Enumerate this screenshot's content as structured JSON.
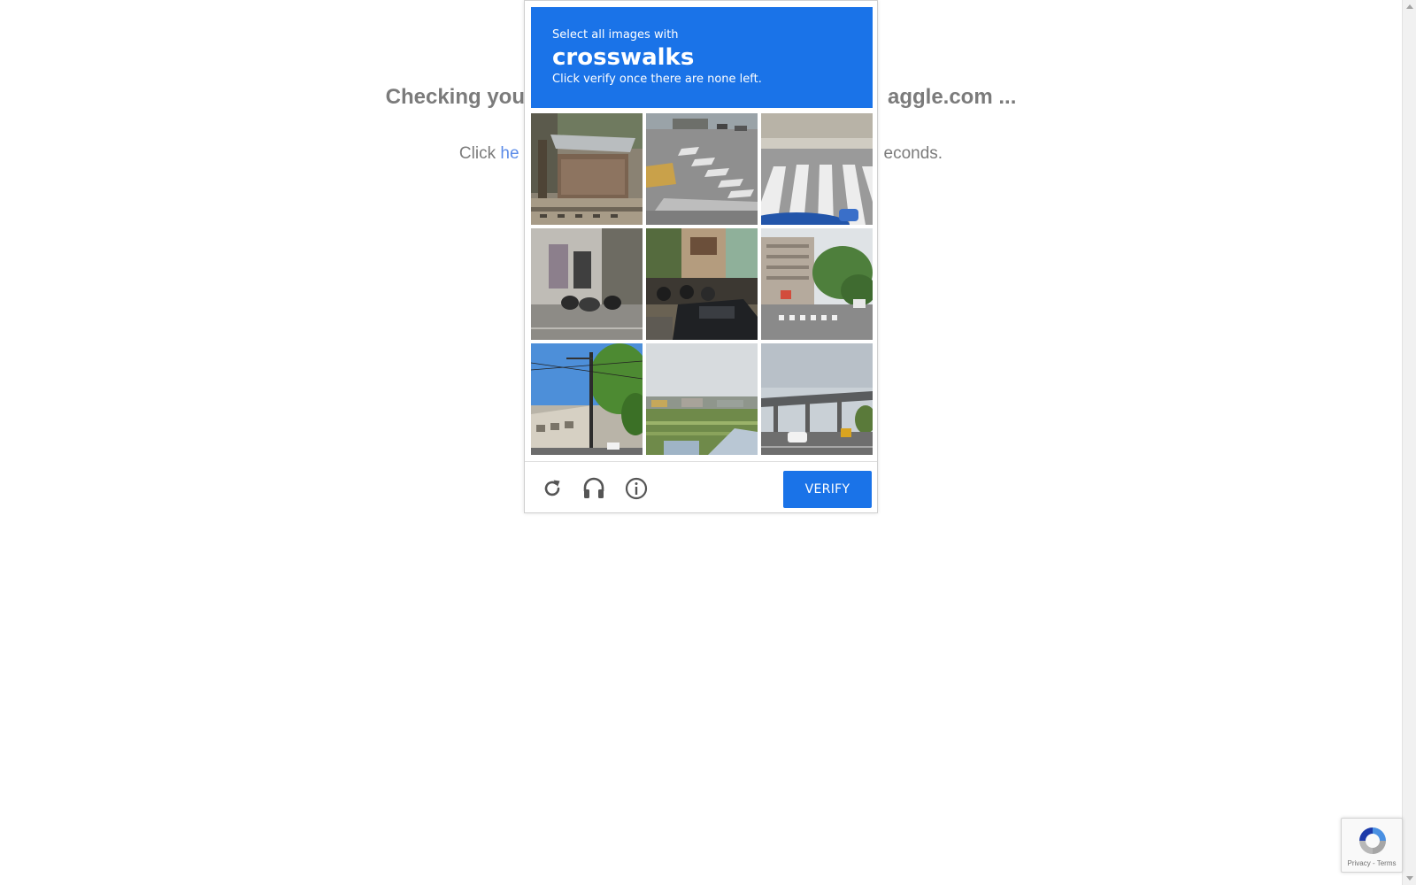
{
  "background": {
    "heading_left": "Checking you",
    "heading_right": "aggle.com ...",
    "line_prefix": "Click ",
    "line_link": "he",
    "line_suffix": "econds."
  },
  "challenge": {
    "instruction": "Select all images with",
    "target_object": "crosswalks",
    "note": "Click verify once there are none left.",
    "tiles": [
      {
        "scene": "market-stall"
      },
      {
        "scene": "intersection-crosswalk"
      },
      {
        "scene": "crosswalk-closeup"
      },
      {
        "scene": "building-scooters"
      },
      {
        "scene": "parked-bikes-car"
      },
      {
        "scene": "street-apartments-crosswalk"
      },
      {
        "scene": "utility-pole-trees"
      },
      {
        "scene": "field-rooftops"
      },
      {
        "scene": "overpass-road"
      }
    ],
    "footer": {
      "reload_icon": "reload-icon",
      "audio_icon": "headphones-icon",
      "info_icon": "info-icon",
      "verify_label": "VERIFY"
    }
  },
  "badge": {
    "privacy_label": "Privacy",
    "separator": " - ",
    "terms_label": "Terms"
  },
  "colors": {
    "accent": "#1a73e8",
    "muted_text": "#7b7b7b",
    "link": "#5c8ce8"
  }
}
